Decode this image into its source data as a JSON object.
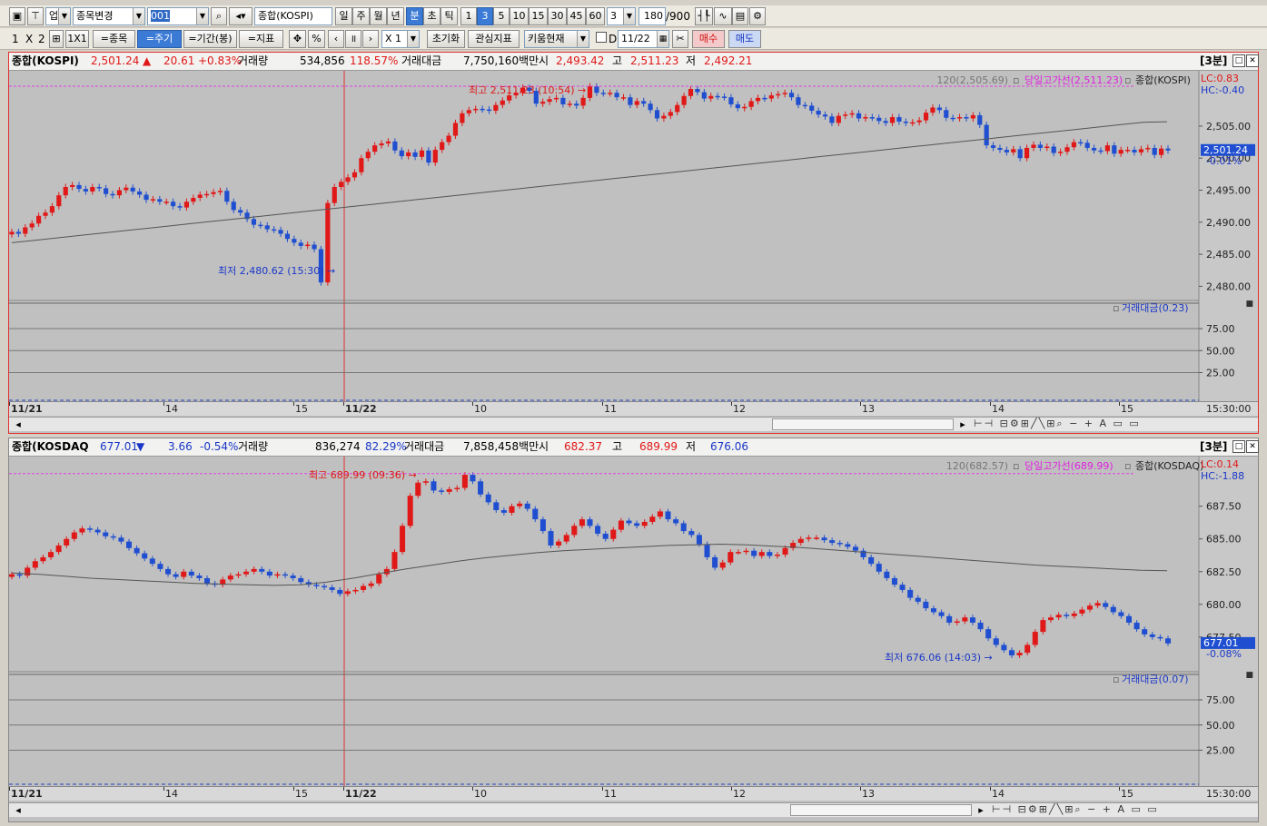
{
  "toolbar1": {
    "category": "업",
    "change_item": "종목변경",
    "code": "001",
    "item_name": "종합(KOSPI)",
    "periods": [
      "일",
      "주",
      "월",
      "년",
      "분",
      "초",
      "틱"
    ],
    "active_period": "분",
    "minutes": [
      "1",
      "3",
      "5",
      "10",
      "15",
      "30",
      "45",
      "60"
    ],
    "active_minute": "3",
    "minute_value": "3",
    "count": "180",
    "count_max": "/900"
  },
  "toolbar2": {
    "layout1": "1",
    "layout_x": "X",
    "layout2": "2",
    "layout_1x1": "1X1",
    "btn_item": "=종목",
    "btn_period": "=주기",
    "btn_range": "=기간(봉)",
    "btn_indicator": "=지표",
    "percent": "%",
    "multiplier": "X 1",
    "reset": "초기화",
    "watch_indicator": "관심지표",
    "kiwoom_now": "키움현재",
    "chk_label": "D",
    "date": "11/22",
    "buy": "매수",
    "sell": "매도"
  },
  "chart_data": [
    {
      "type": "candlestick",
      "name": "종합(KOSPI)",
      "header": {
        "name": "종합(KOSPI)",
        "price": "2,501.24",
        "dir": "▲",
        "change": "20.61",
        "pct": "+0.83%",
        "vol_label": "거래량",
        "volume": "534,856",
        "vol_ratio": "118.57%",
        "amt_label": "거래대금",
        "amount": "7,750,160백만",
        "open_label": "시",
        "open": "2,493.42",
        "high_label": "고",
        "high": "2,511.23",
        "low_label": "저",
        "low": "2,492.21",
        "interval": "[3분]"
      },
      "legend": {
        "ma": "120(2,505.69)",
        "highline": "당일고가선(2,511.23)",
        "series": "종합(KOSPI)"
      },
      "lc": "LC:0.83",
      "hc": "HC:-0.40",
      "current_tag": "2,501.24",
      "current_pct": "-0.01%",
      "high_annot": "최고 2,511.23 (10:54)",
      "low_annot": "최저 2,480.62 (15:30)",
      "y_ticks": [
        "2,505.00",
        "2,500.00",
        "2,495.00",
        "2,490.00",
        "2,485.00",
        "2,480.00"
      ],
      "y_values": [
        2505,
        2500,
        2495,
        2490,
        2485,
        2480
      ],
      "ylim": [
        2478.5,
        2512.5
      ],
      "vol_label": "거래대금(0.23)",
      "vol_ticks": [
        "75.00",
        "50.00",
        "25.00"
      ],
      "x_labels": [
        "11/21",
        "14",
        "15",
        "11/22",
        "10",
        "11",
        "12",
        "13",
        "14",
        "15"
      ],
      "x_time": "15:30:00",
      "closes": [
        2488.5,
        2488.2,
        2489.2,
        2489.8,
        2491,
        2491.5,
        2492.5,
        2494.2,
        2495.5,
        2495.8,
        2495.2,
        2494.8,
        2495.5,
        2495.3,
        2494.4,
        2494.2,
        2495,
        2495.4,
        2494.8,
        2494.3,
        2493.5,
        2493.6,
        2493.2,
        2493.2,
        2492.5,
        2492.3,
        2493.2,
        2493.8,
        2494.3,
        2494.4,
        2494.7,
        2494.9,
        2493.2,
        2491.9,
        2491.5,
        2490.5,
        2489.6,
        2489.5,
        2488.9,
        2488.8,
        2488.2,
        2487.4,
        2486.8,
        2486.3,
        2486.5,
        2485.8,
        2480.6,
        2493,
        2495.5,
        2496.3,
        2497,
        2497.8,
        2500,
        2501,
        2502,
        2502.3,
        2502.6,
        2501.2,
        2500.3,
        2500.9,
        2500.2,
        2501.2,
        2499.3,
        2501.3,
        2502.5,
        2503.5,
        2505.5,
        2507,
        2507.5,
        2507.7,
        2507.6,
        2507.4,
        2508.3,
        2509,
        2509.8,
        2510.2,
        2511,
        2510.5,
        2508.5,
        2508.8,
        2509.2,
        2509.4,
        2508.4,
        2508.5,
        2508.2,
        2509.4,
        2511.2,
        2510.2,
        2510.1,
        2510.2,
        2509.5,
        2509.5,
        2508.3,
        2508.9,
        2508.5,
        2507.5,
        2506.2,
        2506.6,
        2507.2,
        2508.3,
        2509.7,
        2510.8,
        2510.3,
        2509.3,
        2509.7,
        2509.6,
        2509.5,
        2508.4,
        2507.8,
        2508,
        2508.9,
        2509.4,
        2509.3,
        2509.8,
        2510,
        2510.2,
        2509.5,
        2508.3,
        2508.2,
        2507.4,
        2506.8,
        2506.5,
        2505.5,
        2506.6,
        2506.8,
        2507,
        2506.2,
        2506.4,
        2506.3,
        2505.8,
        2505.5,
        2506.4,
        2505.7,
        2505.5,
        2505.6,
        2505.9,
        2507.1,
        2507.9,
        2507.5,
        2506.3,
        2506.2,
        2506.4,
        2506.2,
        2506.7,
        2505.2,
        2502,
        2501.6,
        2501.3,
        2500.9,
        2501.4,
        2500,
        2501.6,
        2502.1,
        2501.6,
        2501.8,
        2500.8,
        2501,
        2501.7,
        2502.5,
        2502.4,
        2501.6,
        2501.2,
        2501.1,
        2502,
        2500.7,
        2501.3,
        2501.3,
        2500.9,
        2501.4,
        2501.6,
        2500.5,
        2501.5,
        2501.2
      ],
      "ma": [
        2486.8,
        2487.2,
        2487.6,
        2488,
        2488.4,
        2488.8,
        2489.2,
        2489.6,
        2490,
        2490.4,
        2490.8,
        2491.2,
        2491.6,
        2492,
        2492.4,
        2492.8,
        2493.2,
        2493.6,
        2494,
        2494.4,
        2494.8,
        2495.2,
        2495.6,
        2496,
        2496.4,
        2496.8,
        2497.2,
        2497.6,
        2498,
        2498.4,
        2498.8,
        2499.2,
        2499.6,
        2500,
        2500.4,
        2500.8,
        2501.2,
        2501.6,
        2502,
        2502.4,
        2502.8,
        2503.2,
        2503.6,
        2504,
        2504.4,
        2504.8,
        2505.2,
        2505.6,
        2505.69
      ]
    },
    {
      "type": "candlestick",
      "name": "종합(KOSDAQ)",
      "header": {
        "name": "종합(KOSDAQ",
        "price": "677.01",
        "dir": "▼",
        "change": "3.66",
        "pct": "-0.54%",
        "vol_label": "거래량",
        "volume": "836,274",
        "vol_ratio": "82.29%",
        "amt_label": "거래대금",
        "amount": "7,858,458백만",
        "open_label": "시",
        "open": "682.37",
        "high_label": "고",
        "high": "689.99",
        "low_label": "저",
        "low": "676.06",
        "interval": "[3분]"
      },
      "legend": {
        "ma": "120(682.57)",
        "highline": "당일고가선(689.99)",
        "series": "종합(KOSDAQ)"
      },
      "lc": "LC:0.14",
      "hc": "HC:-1.88",
      "current_tag": "677.01",
      "current_pct": "-0.08%",
      "high_annot": "최고 689.99 (09:36)",
      "low_annot": "최저 676.06 (14:03)",
      "y_ticks": [
        "687.50",
        "685.00",
        "682.50",
        "680.00",
        "677.50"
      ],
      "y_values": [
        687.5,
        685,
        682.5,
        680,
        677.5
      ],
      "ylim": [
        675.2,
        690.6
      ],
      "vol_label": "거래대금(0.07)",
      "vol_ticks": [
        "75.00",
        "50.00",
        "25.00"
      ],
      "x_labels": [
        "11/21",
        "14",
        "15",
        "11/22",
        "10",
        "11",
        "12",
        "13",
        "14",
        "15"
      ],
      "x_time": "15:30:00",
      "closes": [
        682.3,
        682.2,
        682.8,
        683.3,
        683.6,
        684,
        684.5,
        685,
        685.5,
        685.8,
        685.7,
        685.5,
        685.2,
        685.1,
        684.8,
        684.3,
        683.9,
        683.5,
        683.1,
        682.7,
        682.3,
        682.1,
        682.5,
        682.2,
        682,
        681.6,
        681.5,
        681.9,
        682.2,
        682.3,
        682.5,
        682.7,
        682.5,
        682.2,
        682.3,
        682.2,
        682,
        681.7,
        681.5,
        681.4,
        681.3,
        681.1,
        680.8,
        681,
        681.1,
        681.4,
        681.6,
        682.3,
        682.7,
        684,
        686,
        688.3,
        689.3,
        689.4,
        688.7,
        688.6,
        688.8,
        688.9,
        689.9,
        689.4,
        688.4,
        687.8,
        687.2,
        687,
        687.5,
        687.7,
        687.3,
        686.5,
        685.6,
        684.5,
        684.8,
        685.3,
        686,
        686.5,
        686,
        685.4,
        685,
        685.7,
        686.4,
        686.2,
        686,
        686.3,
        686.7,
        687.1,
        686.5,
        686.2,
        685.6,
        685.3,
        684.6,
        683.6,
        682.8,
        683.2,
        684,
        684,
        684.1,
        683.7,
        684,
        683.7,
        683.8,
        684.3,
        684.7,
        685,
        685.1,
        685.1,
        684.9,
        684.7,
        684.6,
        684.4,
        684.1,
        683.6,
        683.1,
        682.5,
        682,
        681.5,
        681.1,
        680.5,
        680.2,
        679.7,
        679.4,
        679.1,
        678.6,
        678.7,
        679,
        678.6,
        678.1,
        677.4,
        676.9,
        676.5,
        676.1,
        676.3,
        676.9,
        677.9,
        678.8,
        679,
        679.2,
        679.1,
        679.3,
        679.6,
        679.9,
        680.1,
        679.8,
        679.4,
        679.1,
        678.6,
        678.1,
        677.7,
        677.5,
        677.4,
        677.01
      ],
      "ma": [
        682.4,
        682.3,
        682.15,
        682.0,
        681.9,
        681.8,
        681.7,
        681.6,
        681.55,
        681.5,
        681.45,
        681.5,
        681.7,
        682.0,
        682.35,
        682.7,
        683.0,
        683.3,
        683.55,
        683.75,
        683.95,
        684.1,
        684.2,
        684.3,
        684.4,
        684.5,
        684.55,
        684.6,
        684.55,
        684.45,
        684.35,
        684.2,
        684.05,
        683.9,
        683.75,
        683.6,
        683.45,
        683.3,
        683.15,
        683.0,
        682.9,
        682.8,
        682.7,
        682.6,
        682.57
      ]
    }
  ]
}
